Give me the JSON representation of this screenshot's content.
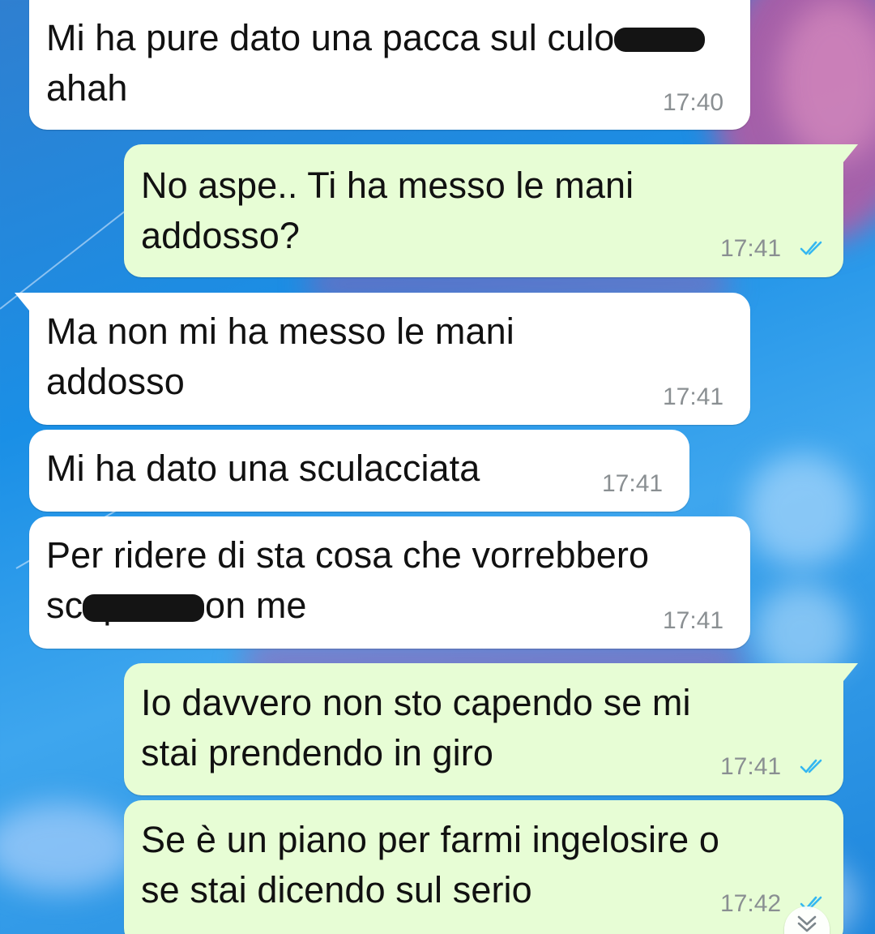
{
  "chat": {
    "messages": [
      {
        "direction": "incoming",
        "lines": [
          "Mi ha pure dato una pacca sul culo",
          "ahah"
        ],
        "time": "17:40",
        "redacted": "culo"
      },
      {
        "direction": "outgoing",
        "lines": [
          "No aspe.. Ti ha messo le mani",
          "addosso?"
        ],
        "time": "17:41",
        "status": "read"
      },
      {
        "direction": "incoming",
        "lines": [
          "Ma non mi ha messo le mani",
          "addosso"
        ],
        "time": "17:41"
      },
      {
        "direction": "incoming",
        "lines": [
          "Mi ha dato una sculacciata"
        ],
        "time": "17:41"
      },
      {
        "direction": "incoming",
        "lines": [
          "Per ridere di sta cosa che vorrebbero",
          "scopare con me"
        ],
        "time": "17:41",
        "redacted": "scopare"
      },
      {
        "direction": "outgoing",
        "lines": [
          "Io davvero non sto capendo se mi",
          "stai prendendo in giro"
        ],
        "time": "17:41",
        "status": "read"
      },
      {
        "direction": "outgoing",
        "lines": [
          "Se è un piano per farmi ingelosire o",
          "se stai dicendo sul serio"
        ],
        "time": "17:42",
        "status": "read"
      }
    ]
  },
  "colors": {
    "incoming_bubble": "#ffffff",
    "outgoing_bubble": "#e7fdd5",
    "read_ticks": "#34b7f1",
    "timestamp": "#8a8f92",
    "redaction": "#141414"
  },
  "icons": {
    "read_receipt": "double-check-icon",
    "scroll_down": "chevron-double-down-icon"
  }
}
